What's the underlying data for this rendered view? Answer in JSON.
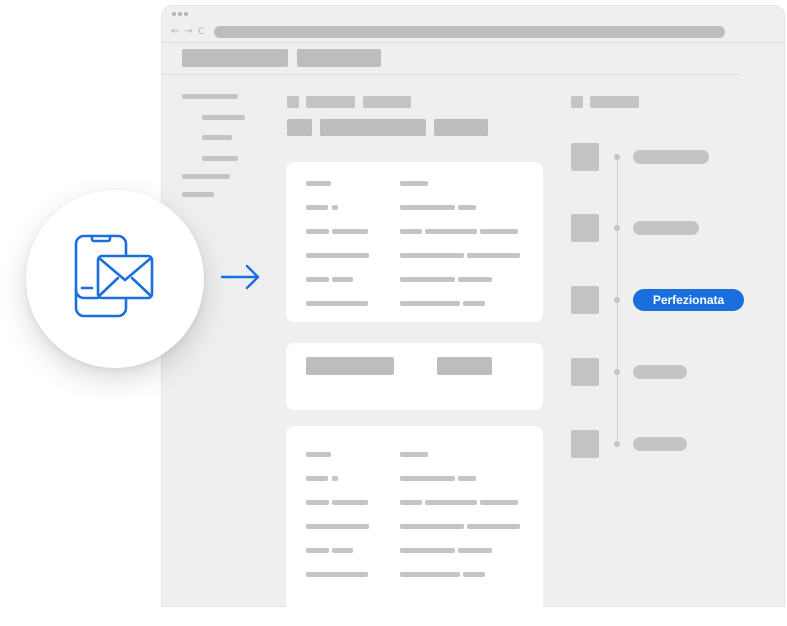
{
  "browser": {
    "nav_icons": [
      "back-arrow-icon",
      "forward-arrow-icon",
      "reload-icon"
    ],
    "nav_glyphs": {
      "back": "←",
      "forward": "→",
      "reload": "C"
    }
  },
  "timeline": {
    "active_status": "Perfezionata"
  },
  "illustration": {
    "icon": "phone-envelope-icon",
    "arrow": "arrow-right-icon"
  },
  "colors": {
    "accent": "#1a6fdd",
    "browser_bg": "#efefef",
    "placeholder": "#c4c4c4",
    "card": "#ffffff"
  }
}
